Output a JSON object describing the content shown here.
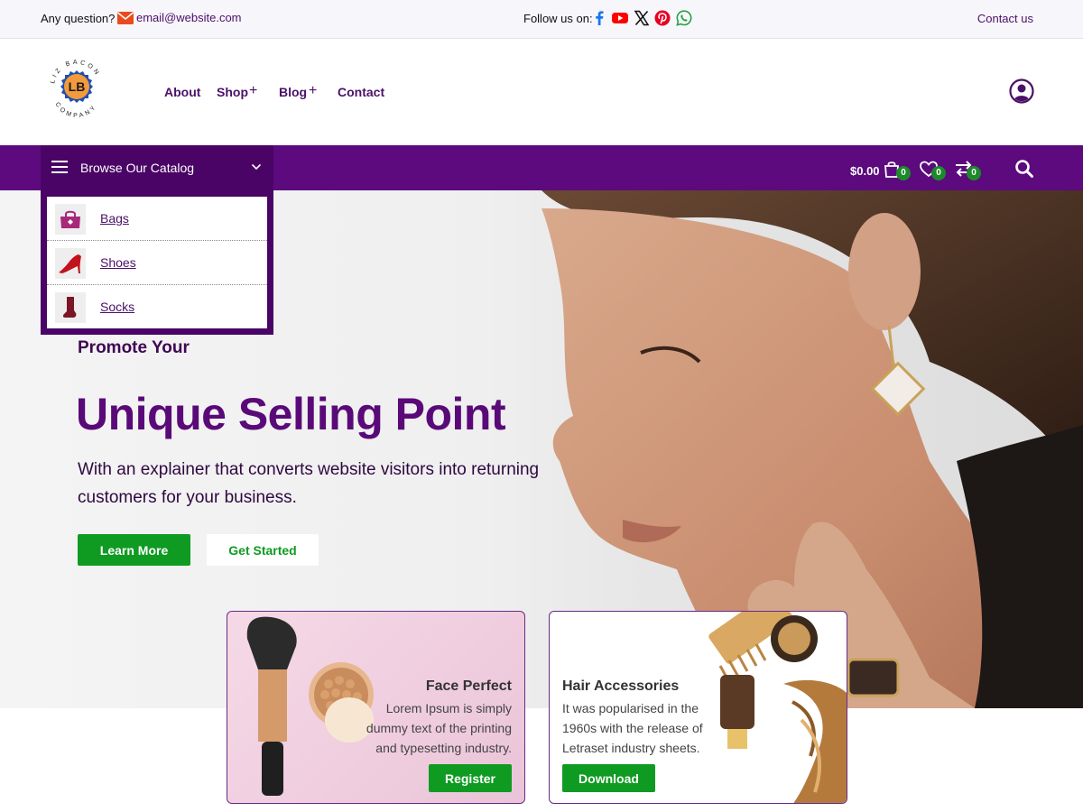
{
  "colors": {
    "brand_purple": "#5c0a7d",
    "brand_purple_dark": "#4a0466",
    "accent_green": "#0f9b22",
    "badge_green": "#1c8a2a",
    "logo_orange": "#f29a3c",
    "logo_blue": "#1f4fb0"
  },
  "topbar": {
    "question_label": "Any question?",
    "email_icon": "envelope-icon",
    "email": "email@website.com",
    "follow_label": "Follow us on:",
    "social_icons": [
      "facebook-icon",
      "youtube-icon",
      "x-icon",
      "pinterest-icon",
      "whatsapp-icon"
    ],
    "contact_link": "Contact us"
  },
  "header": {
    "logo": {
      "initials": "LB",
      "ring_top": "LIZ BACON",
      "ring_bottom": "COMPANY"
    },
    "nav": [
      {
        "label": "About"
      },
      {
        "label": "Shop",
        "expand": "+"
      },
      {
        "label": "Blog",
        "expand": "+"
      },
      {
        "label": "Contact"
      }
    ],
    "user_icon": "user-account-icon"
  },
  "catalog": {
    "title": "Browse Our Catalog",
    "items": [
      {
        "label": "Bags",
        "icon": "bag-icon"
      },
      {
        "label": "Shoes",
        "icon": "high-heel-icon"
      },
      {
        "label": "Socks",
        "icon": "sock-icon"
      }
    ]
  },
  "toolbar": {
    "cart_total": "$0.00",
    "cart_count": "0",
    "wishlist_count": "0",
    "compare_count": "0"
  },
  "hero": {
    "eyebrow": "Promote Your",
    "headline": "Unique Selling Point",
    "description": "With an explainer that converts website visitors into returning customers for your business.",
    "primary_button": "Learn More",
    "secondary_button": "Get Started"
  },
  "cards": [
    {
      "title": "Face Perfect",
      "lines": [
        "Lorem Ipsum is simply",
        "dummy text of the printing",
        "and typesetting industry."
      ],
      "button": "Register"
    },
    {
      "title": "Hair Accessories",
      "lines": [
        "It was popularised in the",
        "1960s with the release of",
        "Letraset industry sheets."
      ],
      "button": "Download"
    }
  ]
}
